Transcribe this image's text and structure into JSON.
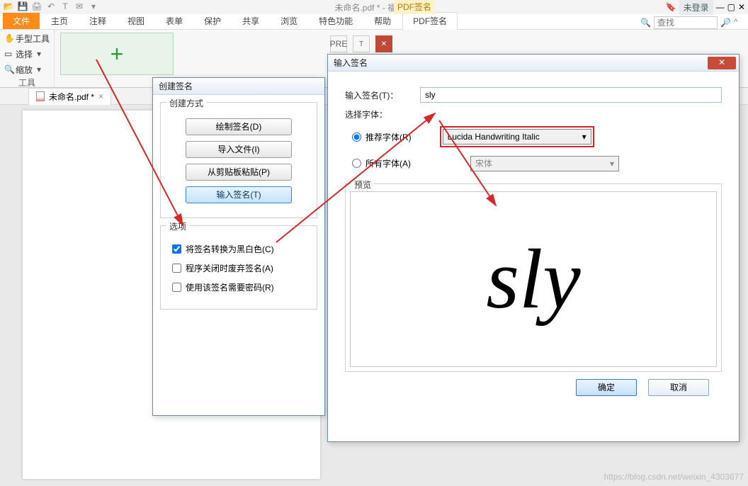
{
  "titlebar": {
    "doc_title": "未命名.pdf * - 福昕阅读器",
    "login": "未登录",
    "search_placeholder": "查找"
  },
  "ribbon": {
    "tabs": {
      "file": "文件",
      "home": "主页",
      "annotate": "注释",
      "view": "视图",
      "form": "表单",
      "protect": "保护",
      "share": "共享",
      "browse": "浏览",
      "features": "特色功能",
      "help": "帮助",
      "pdfsign": "PDF签名",
      "pdfsign_context": "PDF签名"
    },
    "tools": {
      "hand": "手型工具",
      "select": "选择",
      "zoom": "缩放",
      "group": "工具"
    },
    "extra": {
      "pre": "PRE"
    }
  },
  "doc_tab": {
    "name": "未命名.pdf *"
  },
  "dlg_create": {
    "title": "创建签名",
    "method_group": "创建方式",
    "draw": "绘制签名(D)",
    "import": "导入文件(I)",
    "paste": "从剪贴板粘贴(P)",
    "type": "输入签名(T)",
    "options_group": "选项",
    "opt_bw": "将签名转换为黑白色(C)",
    "opt_discard": "程序关闭时废弃签名(A)",
    "opt_password": "使用该签名需要密码(R)"
  },
  "dlg_input": {
    "title": "输入签名",
    "label_type": "输入签名(T)：",
    "value": "sly",
    "label_font": "选择字体：",
    "radio_recommended": "推荐字体(R)",
    "radio_all": "所有字体(A)",
    "font_recommended": "Lucida Handwriting Italic",
    "font_all": "宋体",
    "preview_label": "预览",
    "preview_text": "sly",
    "ok": "确定",
    "cancel": "取消"
  },
  "watermark": "https://blog.csdn.net/weixin_4303677"
}
